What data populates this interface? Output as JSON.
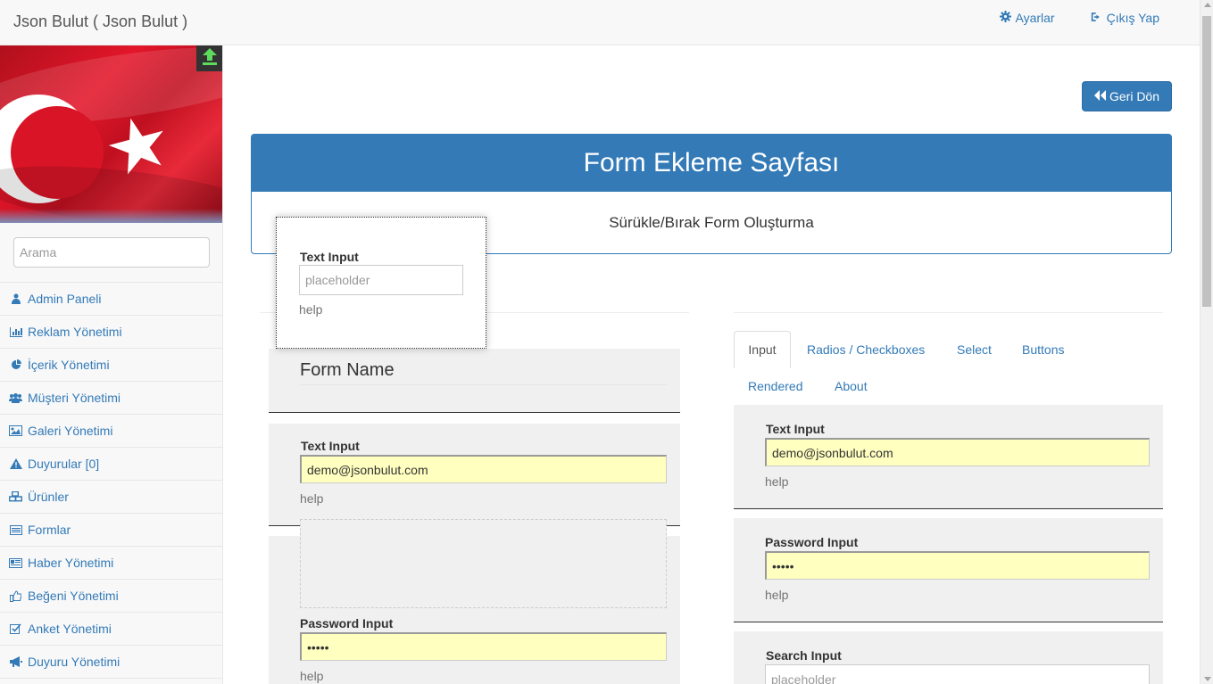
{
  "header": {
    "brand": "Json Bulut ( Json Bulut )",
    "settings_label": "Ayarlar",
    "logout_label": "Çıkış Yap"
  },
  "sidebar": {
    "search_placeholder": "Arama",
    "items": [
      {
        "label": "Admin Paneli",
        "icon": "user-icon"
      },
      {
        "label": "Reklam Yönetimi",
        "icon": "bar-chart-icon"
      },
      {
        "label": "İçerik Yönetimi",
        "icon": "pie-chart-icon"
      },
      {
        "label": "Müşteri Yönetimi",
        "icon": "users-icon"
      },
      {
        "label": "Galeri Yönetimi",
        "icon": "image-icon"
      },
      {
        "label": "Duyurular [0]",
        "icon": "warning-icon"
      },
      {
        "label": "Ürünler",
        "icon": "cubes-icon"
      },
      {
        "label": "Formlar",
        "icon": "list-icon"
      },
      {
        "label": "Haber Yönetimi",
        "icon": "newspaper-icon"
      },
      {
        "label": "Beğeni Yönetimi",
        "icon": "thumbs-up-icon"
      },
      {
        "label": "Anket Yönetimi",
        "icon": "check-square-icon"
      },
      {
        "label": "Duyuru Yönetimi",
        "icon": "bullhorn-icon"
      }
    ]
  },
  "main": {
    "back_label": "Geri Dön",
    "panel_title": "Form Ekleme Sayfası",
    "panel_subtitle": "Sürükle/Bırak Form Oluşturma"
  },
  "drag_item": {
    "label": "Text Input",
    "placeholder": "placeholder",
    "help": "help"
  },
  "builder": {
    "form_name": "Form Name",
    "text_input": {
      "label": "Text Input",
      "value": "demo@jsonbulut.com",
      "help": "help"
    },
    "password_input": {
      "label": "Password Input",
      "value": "•••••",
      "help": "help"
    }
  },
  "palette": {
    "tabs": [
      "Input",
      "Radios / Checkboxes",
      "Select",
      "Buttons",
      "Rendered",
      "About"
    ],
    "active_tab": "Input",
    "text_input": {
      "label": "Text Input",
      "value": "demo@jsonbulut.com",
      "help": "help"
    },
    "password_input": {
      "label": "Password Input",
      "value": "•••••",
      "help": "help"
    },
    "search_input": {
      "label": "Search Input",
      "placeholder": "placeholder"
    }
  },
  "colors": {
    "primary": "#337ab7",
    "input_highlight": "#ffffc0",
    "block_bg": "#f0f0f0"
  }
}
